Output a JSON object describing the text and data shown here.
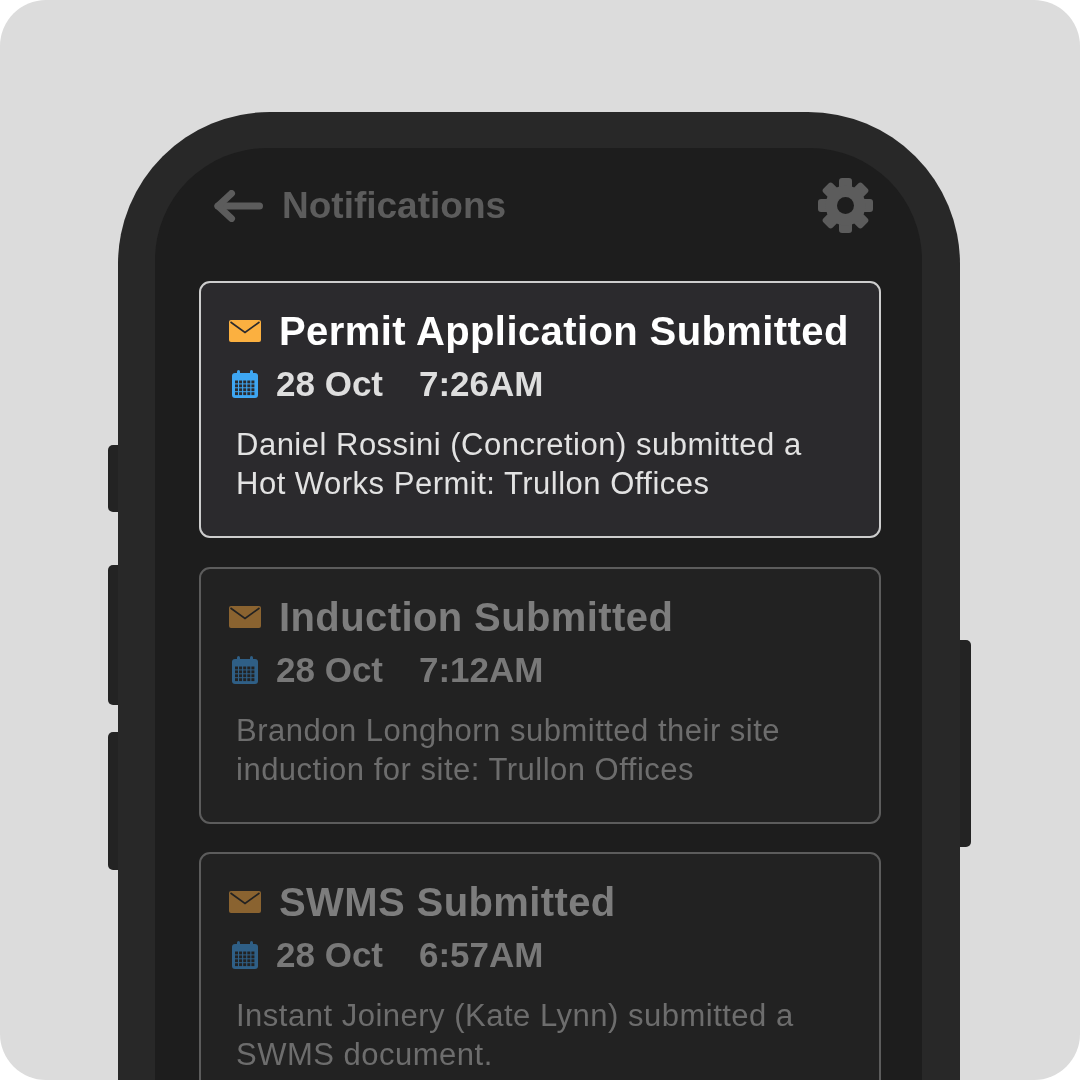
{
  "header": {
    "title": "Notifications"
  },
  "notifications": [
    {
      "title": "Permit Application Submitted",
      "date": "28 Oct",
      "time": "7:26AM",
      "message": "Daniel Rossini (Concretion) submitted a Hot Works Permit: Trullon Offices",
      "selected": true
    },
    {
      "title": "Induction Submitted",
      "date": "28 Oct",
      "time": "7:12AM",
      "message": "Brandon Longhorn submitted their site induction for site: Trullon Offices",
      "selected": false
    },
    {
      "title": "SWMS Submitted",
      "date": "28 Oct",
      "time": "6:57AM",
      "message": "Instant Joinery (Kate Lynn) submitted a SWMS document.",
      "selected": false
    }
  ]
}
